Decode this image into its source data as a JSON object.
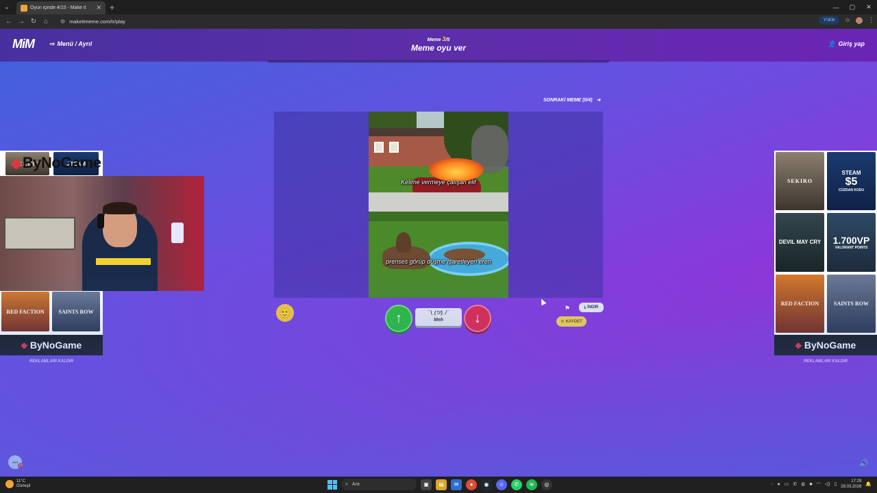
{
  "browser": {
    "tab_title": "Oyun içinde 4/10 - Make it",
    "url": "makeitmeme.com/tr/play",
    "update_label": "Yükle"
  },
  "header": {
    "logo": "MiM",
    "menu_label": "Menü / Ayrıl",
    "meme_prefix": "Meme",
    "meme_current": "3",
    "meme_total": "/5",
    "title": "Meme oyu ver",
    "login_label": "Giriş yap"
  },
  "game": {
    "next_meme_label": "SONRAKİ MEME (0/4)",
    "caption_top": "Kelime vermeye çalışan elif",
    "caption_bottom": "prenses görüp düşme işaretleyen eren",
    "meh_face": "¯\\_(ツ)_/¯",
    "meh_label": "Meh",
    "download_label": "İNDİR",
    "save_label": "KAYDET",
    "up_arrow": "↑",
    "down_arrow": "↓"
  },
  "ads": {
    "left_games": [
      "RED FACTION",
      "SAINTS ROW"
    ],
    "right_games": [
      {
        "name": "SEKIRO",
        "sub": ""
      },
      {
        "name": "STEAM",
        "sub": "$5",
        "extra": "CÜZDAN KODU"
      },
      {
        "name": "DEVIL MAY CRY",
        "sub": ""
      },
      {
        "name": "1.700VP",
        "sub": "VALORANT POINTS"
      },
      {
        "name": "RED FACTION",
        "sub": ""
      },
      {
        "name": "SAINTS ROW",
        "sub": ""
      }
    ],
    "brand": "ByNoGame",
    "remove_label": "REKLAMLARI KALDIR",
    "overlay_partial": [
      "SEKIRO",
      "STEAM"
    ]
  },
  "streamer": {
    "brand": "ByNoGame"
  },
  "chat": {
    "badge": "19"
  },
  "taskbar": {
    "weather_temp": "11°C",
    "weather_cond": "Güneşli",
    "search_label": "Ara",
    "time": "17:29",
    "date": "28.03.2026"
  },
  "colors": {
    "accent_green": "#2dbe3b",
    "accent_red": "#e2294d",
    "accent_yellow": "#f5d24e",
    "brand_red": "#e2353b"
  }
}
